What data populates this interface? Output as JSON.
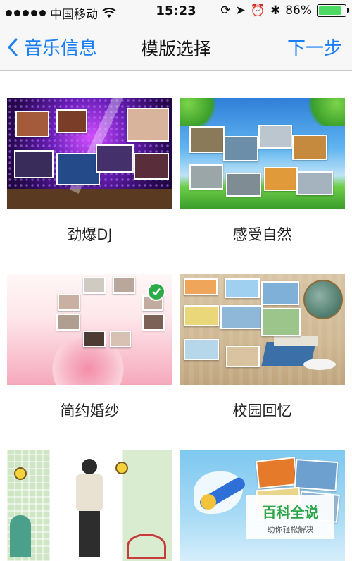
{
  "status": {
    "carrier": "中国移动",
    "time": "15:23",
    "battery": "86%",
    "battery_level": 0.86
  },
  "nav": {
    "back_label": "音乐信息",
    "title": "模版选择",
    "next_label": "下一步"
  },
  "templates": [
    {
      "label": "劲爆DJ",
      "selected": false
    },
    {
      "label": "感受自然",
      "selected": false
    },
    {
      "label": "简约婚纱",
      "selected": true
    },
    {
      "label": "校园回忆",
      "selected": false
    }
  ],
  "watermark": {
    "title": "百科全说",
    "subtitle": "助你轻松解决"
  },
  "colors": {
    "accent": "#1a7ff4",
    "check": "#2daa4a",
    "battery": "#4cd964"
  }
}
